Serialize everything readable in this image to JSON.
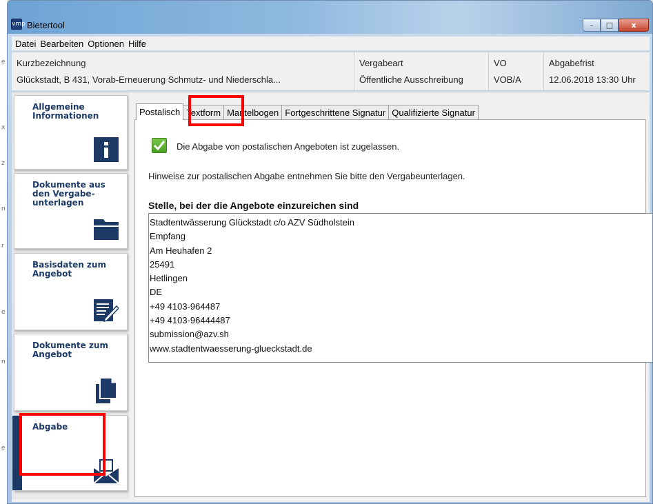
{
  "window": {
    "title": "Bietertool",
    "icon_text": "vmp",
    "controls": {
      "minimize": "–",
      "maximize": "□",
      "close": "x"
    }
  },
  "menu": [
    "Datei",
    "Bearbeiten",
    "Optionen",
    "Hilfe"
  ],
  "info": {
    "kurz": {
      "label": "Kurzbezeichnung",
      "value": "Glückstadt, B 431, Vorab-Erneuerung Schmutz- und Niederschla..."
    },
    "vergabeart": {
      "label": "Vergabeart",
      "value": "Öffentliche Ausschreibung"
    },
    "vo": {
      "label": "VO",
      "value": "VOB/A"
    },
    "frist": {
      "label": "Abgabefrist",
      "value": "12.06.2018 13:30 Uhr"
    }
  },
  "sidebar": {
    "items": [
      {
        "label": "Allgemeine Informationen",
        "icon": "info-icon"
      },
      {
        "label": "Dokumente aus den Vergabe-unterlagen",
        "icon": "folder-icon"
      },
      {
        "label": "Basisdaten zum Angebot",
        "icon": "edit-form-icon"
      },
      {
        "label": "Dokumente zum Angebot",
        "icon": "documents-icon"
      },
      {
        "label": "Abgabe",
        "icon": "envelope-icon"
      }
    ],
    "active_index": 4
  },
  "tabs": [
    "Postalisch",
    "Textform",
    "Mantelbogen",
    "Fortgeschrittene Signatur",
    "Qualifizierte Signatur"
  ],
  "active_tab": 0,
  "postal": {
    "allowed_text": "Die Abgabe von postalischen Angeboten ist zugelassen.",
    "hint": "Hinweise zur postalischen Abgabe entnehmen Sie bitte den Vergabeunterlagen.",
    "heading": "Stelle, bei der die Angebote einzureichen sind",
    "address_lines": [
      "Stadtentwässerung Glückstadt c/o AZV Südholstein",
      "Empfang",
      "Am Heuhafen 2",
      "25491",
      "Hetlingen",
      "DE",
      "+49 4103-964487",
      "+49 4103-96444487",
      "submission@azv.sh",
      "www.stadtentwaesserung-glueckstadt.de"
    ]
  },
  "colors": {
    "sidebar_text": "#1d3a66",
    "highlight": "#ff0000",
    "check_green": "#4a9f25"
  }
}
